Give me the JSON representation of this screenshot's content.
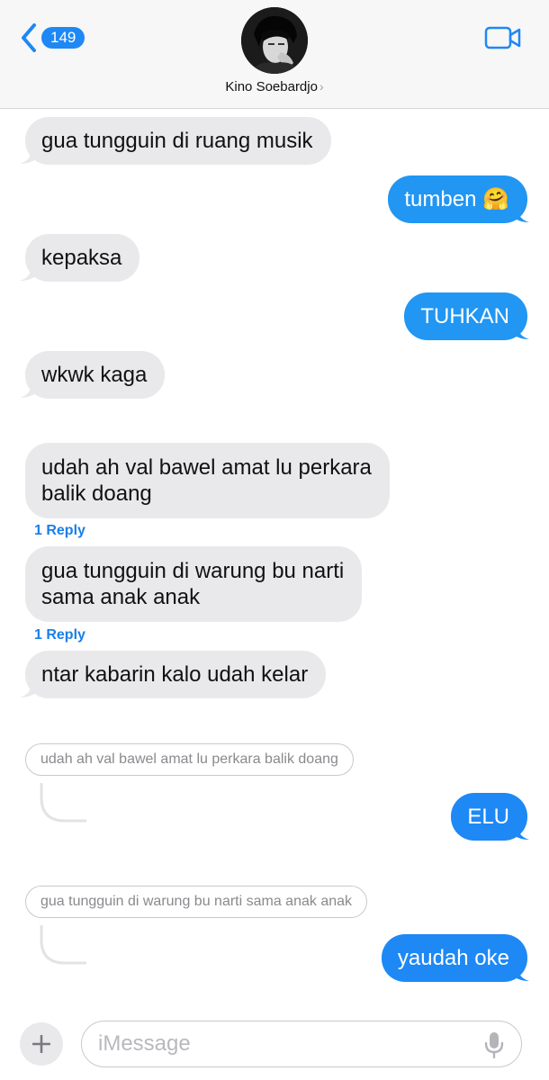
{
  "header": {
    "back_count": "149",
    "contact_name": "Kino Soebardjo",
    "chevron": "›",
    "icons": {
      "back": "chevron-left-icon",
      "video": "video-camera-icon"
    },
    "accent_color": "#1e88f5"
  },
  "messages": [
    {
      "side": "in",
      "text": "gua tungguin di ruang musik"
    },
    {
      "side": "out",
      "text": "tumben 🤗"
    },
    {
      "side": "in",
      "text": "kepaksa"
    },
    {
      "side": "out",
      "text": "TUHKAN"
    },
    {
      "side": "in",
      "text": "wkwk kaga"
    },
    {
      "side": "in",
      "text_line1": "udah ah val bawel amat lu perkara",
      "text_line2": "balik doang",
      "reply": "1 Reply"
    },
    {
      "side": "in",
      "text_line1": "gua tungguin di warung bu narti",
      "text_line2": "sama anak anak",
      "reply": "1 Reply"
    },
    {
      "side": "in",
      "text": "ntar kabarin kalo udah kelar"
    },
    {
      "side": "out",
      "quote": "udah ah val bawel amat lu perkara balik doang",
      "text": "ELU"
    },
    {
      "side": "out",
      "quote": "gua tungguin di warung bu narti sama anak anak",
      "text": "yaudah oke"
    }
  ],
  "input": {
    "placeholder": "iMessage",
    "icons": {
      "add": "plus-icon",
      "mic": "microphone-icon"
    }
  },
  "colors": {
    "incoming_bubble": "#e9e9eb",
    "outgoing_bubble": "#2196f3",
    "reply_link": "#1a7fe8"
  }
}
